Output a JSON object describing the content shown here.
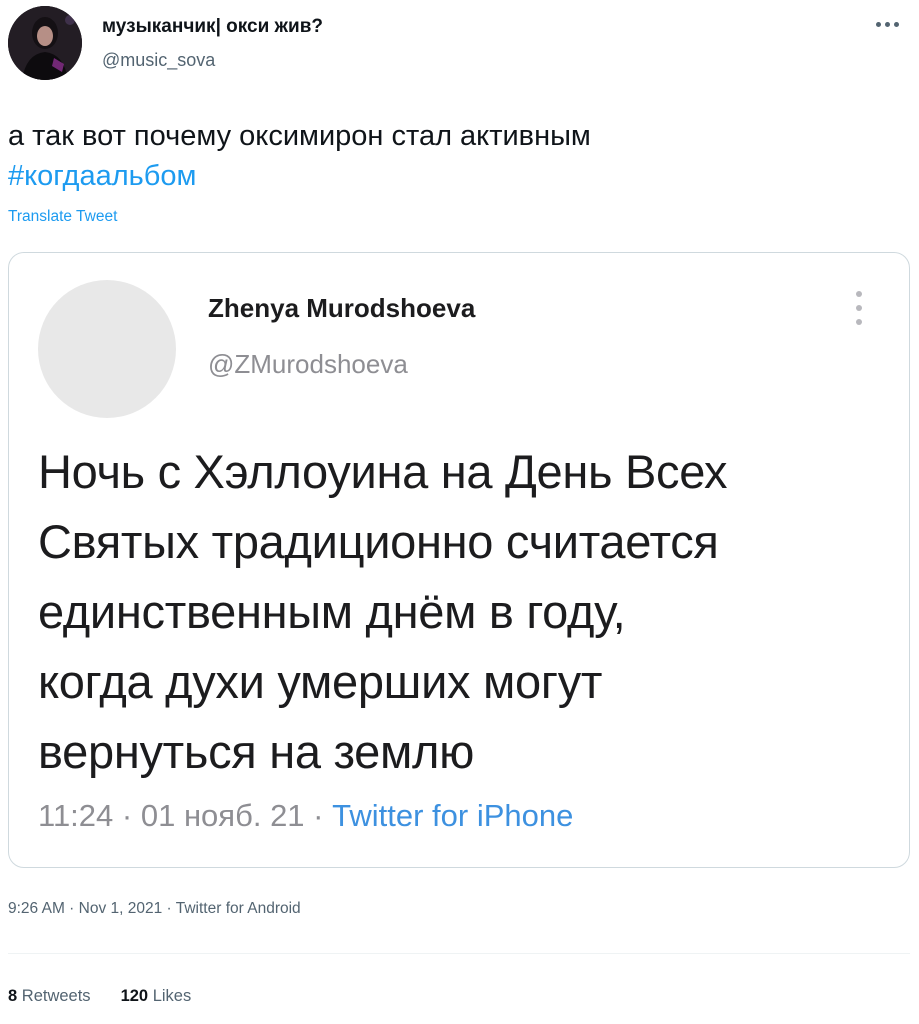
{
  "tweet": {
    "author": {
      "name": "музыканчик| окси жив?",
      "handle": "@music_sova"
    },
    "text_main": "а так вот почему оксимирон стал активным",
    "hashtag": "#когдаальбом",
    "translate_label": "Translate Tweet",
    "timestamp": "9:26 AM",
    "date": "Nov 1, 2021",
    "source": "Twitter for Android",
    "separator": " · ",
    "stats": {
      "retweets_count": "8",
      "retweets_label": "Retweets",
      "likes_count": "120",
      "likes_label": "Likes"
    }
  },
  "quoted_tweet": {
    "name": "Zhenya Murodshoeva",
    "handle": "@ZMurodshoeva",
    "lines": [
      "Ночь с Хэллоуина на День Всех",
      "Святых традиционно считается",
      "единственным днём в году,",
      "когда духи умерших могут",
      "вернуться на землю"
    ],
    "time": "11:24",
    "date": "01 нояб. 21",
    "source": "Twitter for iPhone",
    "separator": " · "
  },
  "icons": {
    "more": "more-horizontal-icon",
    "quoted_more": "more-vertical-icon"
  },
  "colors": {
    "link": "#1d9bf0",
    "text": "#0f1419",
    "secondary": "#536471",
    "border": "#cfd9de"
  }
}
